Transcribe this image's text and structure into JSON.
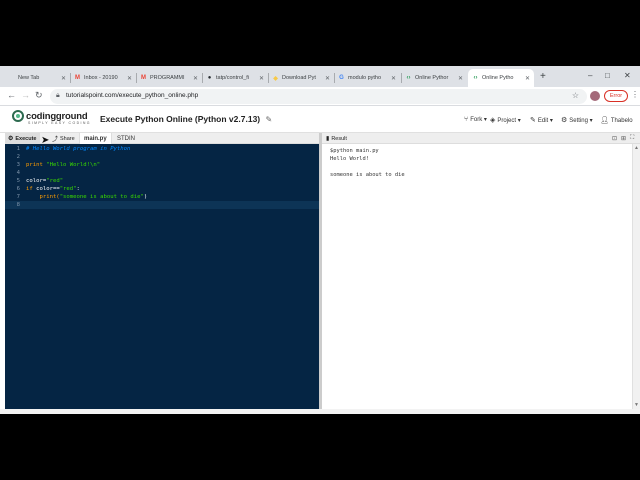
{
  "browser": {
    "tabs": [
      {
        "label": "New Tab",
        "favicon": "",
        "active": false
      },
      {
        "label": "Inbox - 20190",
        "favicon": "M",
        "active": false
      },
      {
        "label": "PROGRAMMI",
        "favicon": "M",
        "active": false
      },
      {
        "label": "tatp/control_fi",
        "favicon": "github",
        "active": false
      },
      {
        "label": "Download Pyt",
        "favicon": "python",
        "active": false
      },
      {
        "label": "modulo pytho",
        "favicon": "G",
        "active": false
      },
      {
        "label": "Online Pythor",
        "favicon": "</>",
        "active": false
      },
      {
        "label": "Online Pytho",
        "favicon": "</>",
        "active": true
      }
    ],
    "url": "tutorialspoint.com/execute_python_online.php",
    "profile_button": "Error",
    "window_controls": [
      "–",
      "□",
      "✕"
    ]
  },
  "site": {
    "logo_text": "codingground",
    "logo_tagline": "SIMPLY EASY CODING",
    "page_title": "Execute Python Online (Python v2.7.13)",
    "menu": [
      {
        "icon": "fork-icon",
        "label": "Fork"
      },
      {
        "icon": "project-icon",
        "label": "Project"
      },
      {
        "icon": "edit-icon",
        "label": "Edit"
      },
      {
        "icon": "settings-icon",
        "label": "Setting"
      },
      {
        "icon": "user-icon",
        "label": "Thabelo"
      }
    ]
  },
  "editor_toolbar": {
    "execute_label": "Execute",
    "share_label": "Share",
    "file_tab": "main.py",
    "stdin_tab": "STDIN"
  },
  "editor": {
    "lines": [
      {
        "n": "1",
        "tokens": [
          {
            "t": "# Hello World program in Python",
            "c": "comment"
          }
        ]
      },
      {
        "n": "2",
        "tokens": []
      },
      {
        "n": "3",
        "tokens": [
          {
            "t": "print ",
            "c": "kw"
          },
          {
            "t": "\"Hello World!\\n\"",
            "c": "str"
          }
        ]
      },
      {
        "n": "4",
        "tokens": []
      },
      {
        "n": "5",
        "tokens": [
          {
            "t": "color=",
            "c": "plain"
          },
          {
            "t": "\"red\"",
            "c": "str"
          }
        ]
      },
      {
        "n": "6",
        "tokens": [
          {
            "t": "if ",
            "c": "kw"
          },
          {
            "t": "color==",
            "c": "plain"
          },
          {
            "t": "\"red\"",
            "c": "str"
          },
          {
            "t": ":",
            "c": "plain"
          }
        ]
      },
      {
        "n": "7",
        "tokens": [
          {
            "t": "    print(",
            "c": "kw"
          },
          {
            "t": "\"someone is about to die\"",
            "c": "str"
          },
          {
            "t": ")",
            "c": "plain"
          }
        ]
      },
      {
        "n": "8",
        "tokens": [],
        "current": true
      }
    ]
  },
  "result": {
    "title": "Result",
    "output_lines": [
      "$python main.py",
      "Hello World!",
      "",
      "someone is about to die"
    ]
  }
}
